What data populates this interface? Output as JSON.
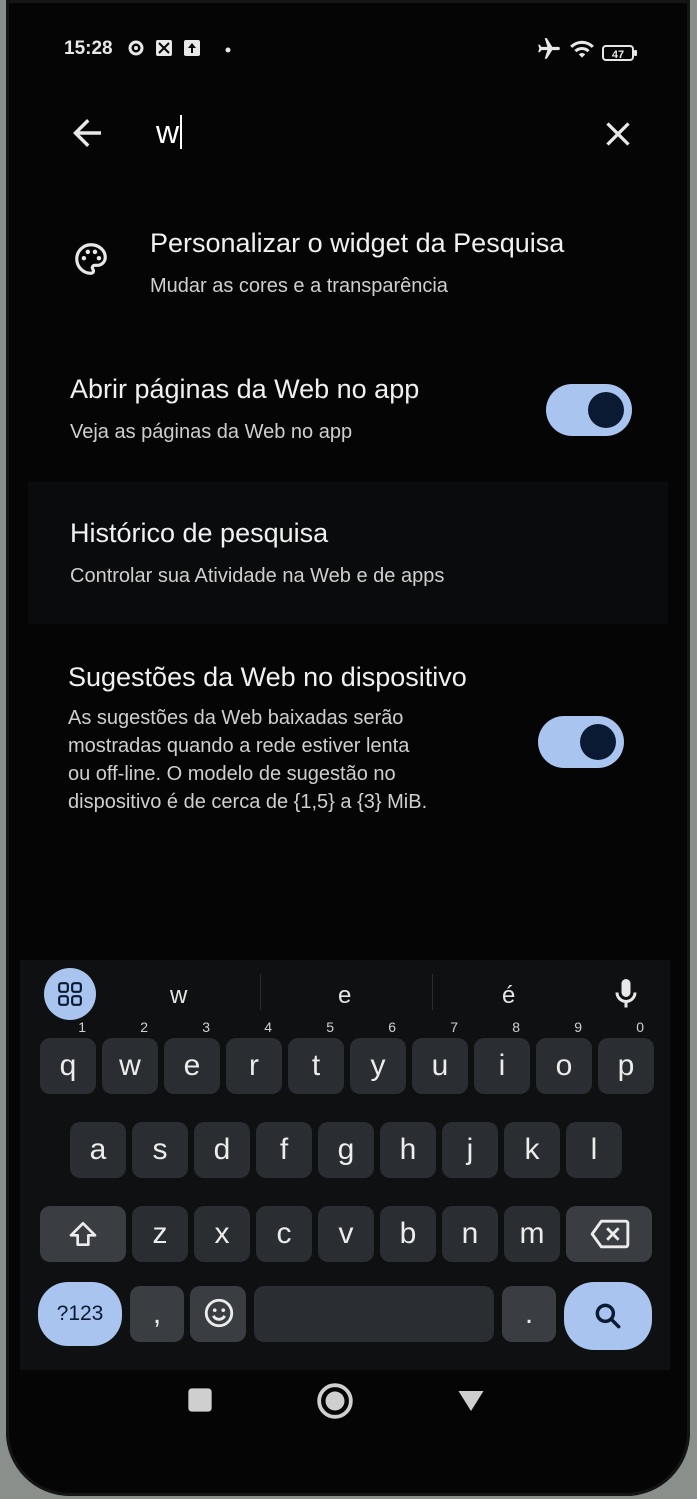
{
  "status_bar": {
    "time": "15:28",
    "battery": "47"
  },
  "search": {
    "query": "w"
  },
  "settings": {
    "customize_widget": {
      "title": "Personalizar o widget da Pesquisa",
      "subtitle": "Mudar as cores e a transparência"
    },
    "open_web_in_app": {
      "title": "Abrir páginas da Web no app",
      "subtitle": "Veja as páginas da Web no app",
      "enabled": true
    },
    "search_history": {
      "title": "Histórico de pesquisa",
      "subtitle": "Controlar sua Atividade na Web e de apps"
    },
    "on_device_suggestions": {
      "title": "Sugestões da Web no dispositivo",
      "subtitle_lines": [
        "As sugestões da Web baixadas serão",
        "mostradas quando a rede estiver lenta",
        "ou off-line. O modelo de sugestão no",
        "dispositivo é de cerca de {1,5} a {3} MiB."
      ],
      "enabled": true
    }
  },
  "keyboard": {
    "suggestions": [
      "w",
      "e",
      "é"
    ],
    "row1": [
      [
        "q",
        "1"
      ],
      [
        "w",
        "2"
      ],
      [
        "e",
        "3"
      ],
      [
        "r",
        "4"
      ],
      [
        "t",
        "5"
      ],
      [
        "y",
        "6"
      ],
      [
        "u",
        "7"
      ],
      [
        "i",
        "8"
      ],
      [
        "o",
        "9"
      ],
      [
        "p",
        "0"
      ]
    ],
    "row2": [
      "a",
      "s",
      "d",
      "f",
      "g",
      "h",
      "j",
      "k",
      "l"
    ],
    "row3": [
      "z",
      "x",
      "c",
      "v",
      "b",
      "n",
      "m"
    ],
    "symbols_label": "?123",
    "comma": ",",
    "period": "."
  },
  "colors": {
    "background": "#050505",
    "toggle_track": "#a9c4ee",
    "toggle_knob": "#0b1a33",
    "key": "#2a2d31"
  },
  "icons": [
    "settings-icon",
    "photos-icon",
    "upload-icon",
    "airplane-icon",
    "wifi-icon",
    "battery-icon",
    "back-arrow-icon",
    "close-icon",
    "palette-icon",
    "apps-grid-icon",
    "mic-icon",
    "shift-icon",
    "backspace-icon",
    "emoji-icon",
    "search-icon",
    "recents-icon",
    "home-icon",
    "back-icon"
  ]
}
